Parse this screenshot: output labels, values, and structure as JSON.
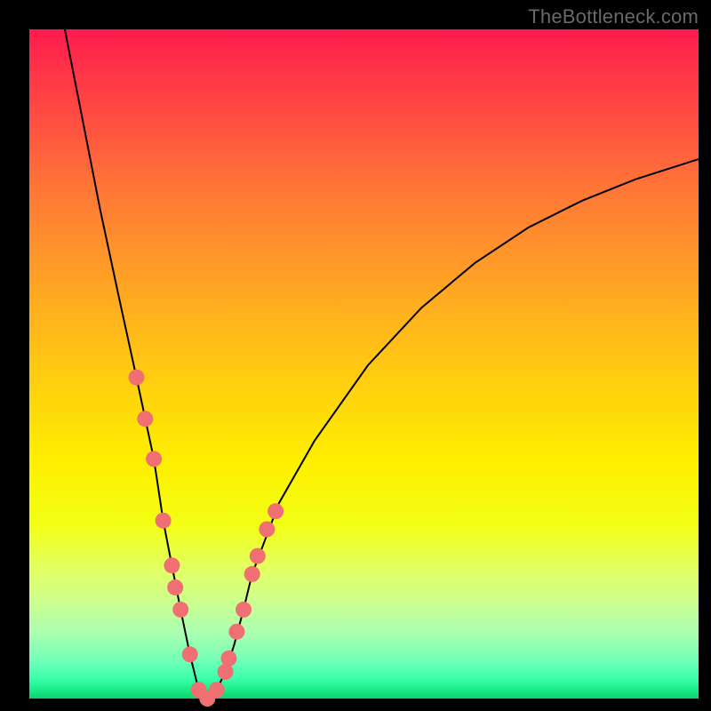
{
  "watermark": "TheBottleneck.com",
  "colors": {
    "frame": "#000000",
    "gradient_top": "#ff1a4d",
    "gradient_bottom": "#0ed070",
    "curve": "#000000",
    "dots": "#ef6f72",
    "watermark_text": "#696969"
  },
  "chart_data": {
    "type": "line",
    "title": "",
    "xlabel": "",
    "ylabel": "",
    "xlim": [
      0,
      100
    ],
    "ylim": [
      0,
      100
    ],
    "grid": false,
    "legend": false,
    "curve_description": "V-shaped bottleneck curve: steep descent from top-left to global minimum near x≈26, then rising concave curve toward upper-right",
    "global_minimum_x": 26.6,
    "series": [
      {
        "name": "bottleneck_curve",
        "x": [
          5.3,
          8.0,
          10.6,
          13.3,
          16.0,
          18.6,
          20.0,
          21.3,
          22.6,
          24.0,
          25.3,
          26.6,
          28.0,
          29.3,
          30.6,
          32.0,
          33.3,
          37.3,
          42.6,
          50.6,
          58.6,
          66.6,
          74.6,
          82.6,
          90.6,
          100.0
        ],
        "y": [
          100.0,
          86.3,
          73.0,
          60.4,
          48.0,
          35.8,
          26.6,
          19.9,
          13.3,
          6.6,
          1.3,
          0.0,
          1.3,
          4.0,
          8.0,
          13.3,
          18.6,
          29.2,
          38.5,
          49.8,
          58.4,
          65.1,
          70.4,
          74.4,
          77.6,
          80.6
        ]
      },
      {
        "name": "sample_points",
        "comment": "salmon colored scatter markers near the valley",
        "x": [
          16.0,
          17.3,
          18.6,
          20.0,
          21.3,
          21.8,
          22.6,
          24.0,
          25.3,
          26.6,
          28.0,
          29.3,
          29.8,
          31.0,
          32.0,
          33.3,
          34.1,
          35.5,
          36.8
        ],
        "y": [
          48.0,
          41.8,
          35.8,
          26.6,
          19.9,
          16.6,
          13.3,
          6.6,
          1.3,
          0.0,
          1.3,
          4.0,
          6.0,
          10.0,
          13.3,
          18.6,
          21.3,
          25.3,
          28.0
        ]
      }
    ]
  }
}
